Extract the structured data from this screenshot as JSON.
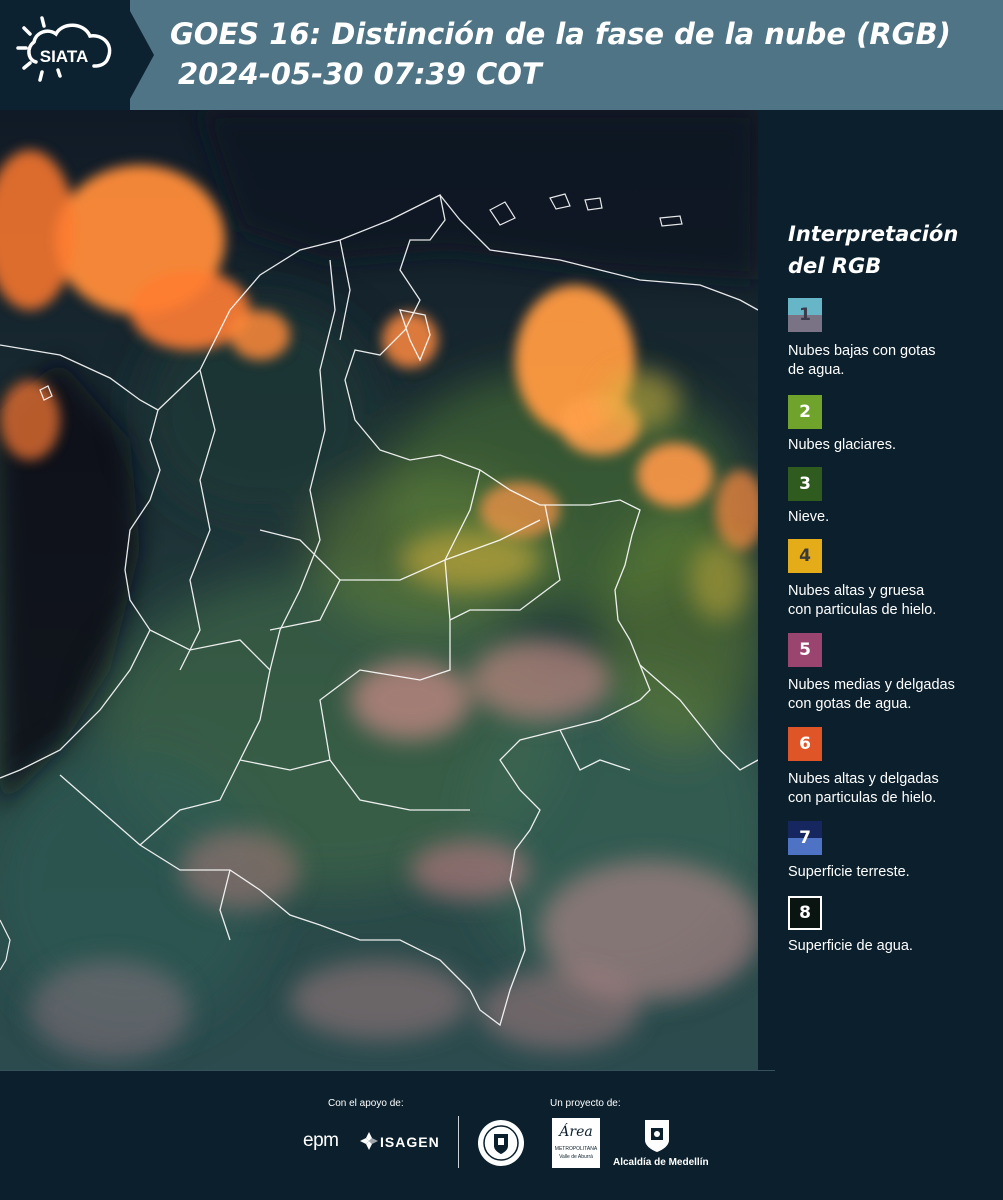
{
  "header": {
    "logo_text": "SIATA",
    "title_line1": "GOES 16: Distinción de la fase de la nube (RGB)",
    "title_line2": "2024-05-30 07:39 COT"
  },
  "legend": {
    "title_line1": "Interpretación",
    "title_line2": "del RGB",
    "items": [
      {
        "number": "1",
        "label_line1": "Nubes bajas con gotas",
        "label_line2": "de agua.",
        "color_top": "#66b6c8",
        "color_bottom": "#7a7385",
        "number_color": "#3a3a4a"
      },
      {
        "number": "2",
        "label_line1": "Nubes glaciares.",
        "label_line2": "",
        "color_top": "#6fa32c",
        "color_bottom": "#6fa32c",
        "number_color": "#ffffff"
      },
      {
        "number": "3",
        "label_line1": "Nieve.",
        "label_line2": "",
        "color_top": "#2f5b1f",
        "color_bottom": "#2f5b1f",
        "number_color": "#ffffff"
      },
      {
        "number": "4",
        "label_line1": "Nubes altas y gruesa",
        "label_line2": "con particulas de hielo.",
        "color_top": "#e3ac18",
        "color_bottom": "#e3ac18",
        "number_color": "#3a3a3a"
      },
      {
        "number": "5",
        "label_line1": "Nubes medias y delgadas",
        "label_line2": "con gotas de agua.",
        "color_top": "#9a4570",
        "color_bottom": "#9a4570",
        "number_color": "#ffffff"
      },
      {
        "number": "6",
        "label_line1": "Nubes altas y delgadas",
        "label_line2": "con particulas de hielo.",
        "color_top": "#e05528",
        "color_bottom": "#e05528",
        "number_color": "#ffffff"
      },
      {
        "number": "7",
        "label_line1": "Superficie terreste.",
        "label_line2": "",
        "color_top": "#16265e",
        "color_bottom": "#4f73c4",
        "number_color": "#ffffff"
      },
      {
        "number": "8",
        "label_line1": "Superficie de agua.",
        "label_line2": "",
        "color_top": "#0a1410",
        "color_bottom": "#0a1410",
        "number_color": "#ffffff"
      }
    ]
  },
  "footer": {
    "support_label": "Con el apoyo de:",
    "project_label": "Un proyecto de:",
    "sponsor1": "epm",
    "sponsor2": "ISAGEN",
    "partner_area_line1": "Área",
    "partner_area_line2": "METROPOLITANA",
    "partner_area_line3": "Valle de Aburrá",
    "partner_alcaldia": "Alcaldía de Medellín"
  },
  "colors": {
    "header_bg": "#4f7485",
    "panel_bg": "#0b1f2c",
    "cloud_orange": "#ff8c3a"
  }
}
